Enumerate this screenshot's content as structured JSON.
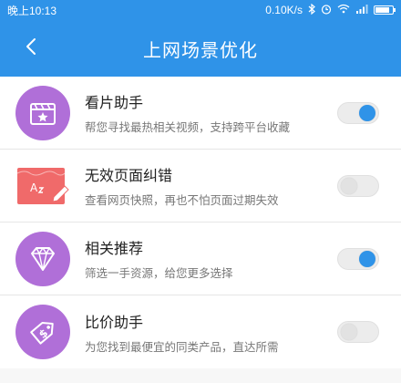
{
  "status_bar": {
    "time": "晚上10:13",
    "speed": "0.10K/s",
    "bluetooth_icon": "bluetooth-icon",
    "alarm_icon": "alarm-icon",
    "wifi_icon": "wifi-icon",
    "signal_icon": "signal-icon",
    "battery_level": 0.85
  },
  "app_bar": {
    "title": "上网场景优化",
    "back_icon": "back-arrow-icon"
  },
  "colors": {
    "primary": "#2f93e8",
    "purple": "#b06fd8",
    "red": "#f06a6a",
    "toggle_on": "#2f93e8",
    "toggle_off": "#e2e2e2"
  },
  "items": [
    {
      "title": "看片助手",
      "desc": "帮您寻找最热相关视频，支持跨平台收藏",
      "icon": "clapperboard-icon",
      "enabled": true
    },
    {
      "title": "无效页面纠错",
      "desc": "查看网页快照，再也不怕页面过期失效",
      "icon": "broken-page-icon",
      "enabled": false
    },
    {
      "title": "相关推荐",
      "desc": "筛选一手资源，给您更多选择",
      "icon": "diamond-icon",
      "enabled": true
    },
    {
      "title": "比价助手",
      "desc": "为您找到最便宜的同类产品，直达所需",
      "icon": "price-tag-icon",
      "enabled": false
    }
  ]
}
